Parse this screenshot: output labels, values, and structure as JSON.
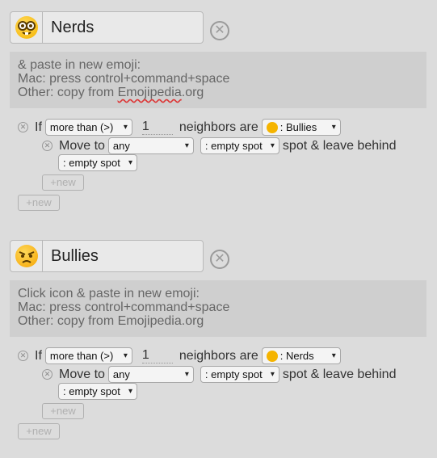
{
  "groups": [
    {
      "name": "Nerds",
      "emoji": "nerd-face",
      "help_lines": [
        "& paste in new emoji:",
        "Mac: press control+command+space",
        "Other: copy from ",
        "Emojipedia",
        ".org"
      ],
      "rule": {
        "if_label": "If",
        "comparator": "more than (>)",
        "count": "1",
        "neighbors_label": "neighbors are",
        "neighbor_target": ": Bullies",
        "move_label": "Move to",
        "move_where": "any",
        "move_target": ": empty spot",
        "leave_label": "spot & leave behind",
        "leave_target": ": empty spot"
      },
      "new_inner": "+new",
      "new_outer": "+new"
    },
    {
      "name": "Bullies",
      "emoji": "angry-face",
      "help_lines": [
        "Click icon & paste in new emoji:",
        "Mac: press control+command+space",
        "Other: copy from Emojipedia.org"
      ],
      "rule": {
        "if_label": "If",
        "comparator": "more than (>)",
        "count": "1",
        "neighbors_label": "neighbors are",
        "neighbor_target": ": Nerds",
        "move_label": "Move to",
        "move_where": "any",
        "move_target": ": empty spot",
        "leave_label": "spot & leave behind",
        "leave_target": ": empty spot"
      },
      "new_inner": "+new",
      "new_outer": "+new"
    }
  ],
  "icons": {
    "close": "⊗",
    "chevron": "⌄"
  }
}
